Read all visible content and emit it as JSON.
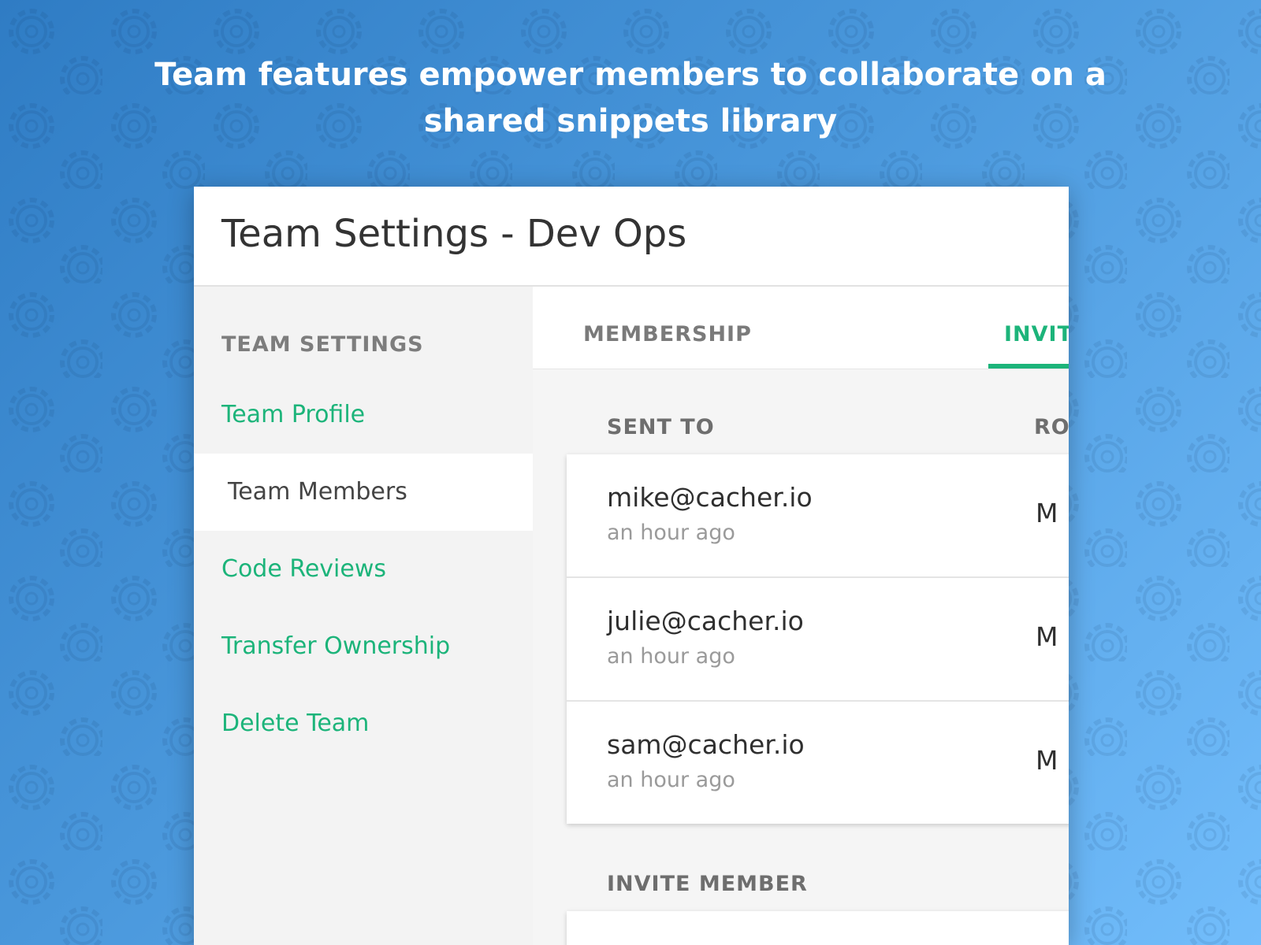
{
  "headline": {
    "line1": "Team features empower members to collaborate on a",
    "line2": "shared snippets library"
  },
  "window": {
    "title": "Team Settings - Dev Ops"
  },
  "sidebar": {
    "heading": "TEAM SETTINGS",
    "items": [
      {
        "label": "Team Profile",
        "active": false
      },
      {
        "label": "Team Members",
        "active": true
      },
      {
        "label": "Code Reviews",
        "active": false
      },
      {
        "label": "Transfer Ownership",
        "active": false
      },
      {
        "label": "Delete Team",
        "active": false
      }
    ]
  },
  "tabs": [
    {
      "label": "MEMBERSHIP",
      "active": false
    },
    {
      "label": "INVITATIONS",
      "active": true
    }
  ],
  "invitations": {
    "columns": [
      "SENT TO",
      "RO"
    ],
    "rows": [
      {
        "email": "mike@cacher.io",
        "sent": "an hour ago",
        "role": "M"
      },
      {
        "email": "julie@cacher.io",
        "sent": "an hour ago",
        "role": "M"
      },
      {
        "email": "sam@cacher.io",
        "sent": "an hour ago",
        "role": "M"
      }
    ]
  },
  "invite_member": {
    "heading": "INVITE MEMBER"
  },
  "colors": {
    "accent": "#1cb47a",
    "bg_start": "#2f7cc4",
    "bg_end": "#72bdfb"
  }
}
